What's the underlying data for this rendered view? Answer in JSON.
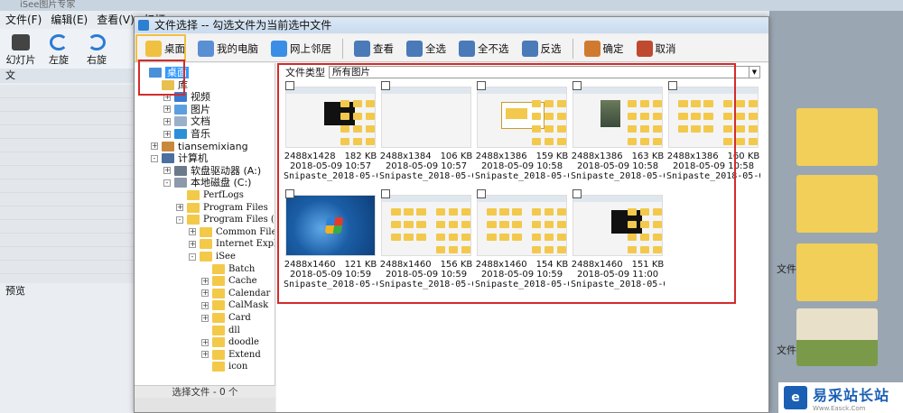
{
  "app": {
    "title": "iSee图片专家",
    "menus": [
      "文件(F)",
      "编辑(E)",
      "查看(V)",
      "幻灯"
    ],
    "toolbar": [
      {
        "label": "幻灯片",
        "icon": "film-icon"
      },
      {
        "label": "左旋",
        "icon": "rotate-left-icon"
      },
      {
        "label": "右旋",
        "icon": "rotate-right-icon"
      }
    ],
    "left_tab": "文",
    "preview_label": "预览",
    "right_folder_labels": [
      "文件",
      "文件"
    ]
  },
  "dialog": {
    "title": "文件选择 -- 勾选文件为当前选中文件",
    "toolbar": [
      {
        "label": "桌面",
        "icon": "desktop-icon",
        "color": "#f0c040"
      },
      {
        "label": "我的电脑",
        "icon": "computer-icon",
        "color": "#5b8fd4"
      },
      {
        "label": "网上邻居",
        "icon": "network-icon",
        "color": "#3a8ee6"
      },
      {
        "label": "查看",
        "icon": "view-grid-icon",
        "color": "#4a7ab8"
      },
      {
        "label": "全选",
        "icon": "select-all-icon",
        "color": "#4a7ab8"
      },
      {
        "label": "全不选",
        "icon": "select-none-icon",
        "color": "#4a7ab8"
      },
      {
        "label": "反选",
        "icon": "invert-selection-icon",
        "color": "#4a7ab8"
      },
      {
        "label": "确定",
        "icon": "confirm-icon",
        "color": "#d07a30"
      },
      {
        "label": "取消",
        "icon": "cancel-icon",
        "color": "#c04a30"
      }
    ],
    "tree": [
      {
        "label": "桌面",
        "level": 0,
        "expander": "",
        "icon": "desktop-icon",
        "selected": true
      },
      {
        "label": "库",
        "level": 1,
        "expander": "",
        "icon": "library-icon"
      },
      {
        "label": "视频",
        "level": 2,
        "expander": "+",
        "icon": "video-icon"
      },
      {
        "label": "图片",
        "level": 2,
        "expander": "+",
        "icon": "picture-icon"
      },
      {
        "label": "文档",
        "level": 2,
        "expander": "+",
        "icon": "document-icon"
      },
      {
        "label": "音乐",
        "level": 2,
        "expander": "+",
        "icon": "music-icon"
      },
      {
        "label": "tiansemixiang",
        "level": 1,
        "expander": "+",
        "icon": "user-folder-icon"
      },
      {
        "label": "计算机",
        "level": 1,
        "expander": "-",
        "icon": "computer-icon"
      },
      {
        "label": "软盘驱动器 (A:)",
        "level": 2,
        "expander": "+",
        "icon": "floppy-icon"
      },
      {
        "label": "本地磁盘 (C:)",
        "level": 2,
        "expander": "-",
        "icon": "disk-icon"
      },
      {
        "label": "PerfLogs",
        "level": 3,
        "expander": "",
        "icon": "folder-icon",
        "mono": true
      },
      {
        "label": "Program Files",
        "level": 3,
        "expander": "+",
        "icon": "folder-icon",
        "mono": true
      },
      {
        "label": "Program Files (x86",
        "level": 3,
        "expander": "-",
        "icon": "folder-icon",
        "mono": true
      },
      {
        "label": "Common Files",
        "level": 4,
        "expander": "+",
        "icon": "folder-icon",
        "mono": true
      },
      {
        "label": "Internet Explor",
        "level": 4,
        "expander": "+",
        "icon": "folder-icon",
        "mono": true
      },
      {
        "label": "iSee",
        "level": 4,
        "expander": "-",
        "icon": "folder-icon",
        "mono": true
      },
      {
        "label": "Batch",
        "level": 5,
        "expander": "",
        "icon": "folder-icon",
        "mono": true
      },
      {
        "label": "Cache",
        "level": 5,
        "expander": "+",
        "icon": "folder-icon",
        "mono": true
      },
      {
        "label": "Calendar",
        "level": 5,
        "expander": "+",
        "icon": "folder-icon",
        "mono": true
      },
      {
        "label": "CalMask",
        "level": 5,
        "expander": "+",
        "icon": "folder-icon",
        "mono": true
      },
      {
        "label": "Card",
        "level": 5,
        "expander": "+",
        "icon": "folder-icon",
        "mono": true
      },
      {
        "label": "dll",
        "level": 5,
        "expander": "",
        "icon": "folder-icon",
        "mono": true
      },
      {
        "label": "doodle",
        "level": 5,
        "expander": "+",
        "icon": "folder-icon",
        "mono": true
      },
      {
        "label": "Extend",
        "level": 5,
        "expander": "+",
        "icon": "folder-icon",
        "mono": true
      },
      {
        "label": "icon",
        "level": 5,
        "expander": "",
        "icon": "folder-icon",
        "mono": true
      }
    ],
    "status": "选择文件 - 0 个",
    "filter": {
      "label": "文件类型",
      "value": "所有图片"
    },
    "thumbnails": [
      {
        "dims": "2488x1428",
        "size": "182 KB",
        "date": "2018-05-09 10:57",
        "name": "Snipaste_2018-05-0...",
        "kind": "black-panel"
      },
      {
        "dims": "2488x1384",
        "size": "106 KB",
        "date": "2018-05-09 10:57",
        "name": "Snipaste_2018-05-0...",
        "kind": "plain"
      },
      {
        "dims": "2488x1386",
        "size": "159 KB",
        "date": "2018-05-09 10:58",
        "name": "Snipaste_2018-05-0...",
        "kind": "dialog"
      },
      {
        "dims": "2488x1386",
        "size": "163 KB",
        "date": "2018-05-09 10:58",
        "name": "Snipaste_2018-05-0...",
        "kind": "photo"
      },
      {
        "dims": "2488x1386",
        "size": "160 KB",
        "date": "2018-05-09 10:58",
        "name": "Snipaste_2018-05-0...",
        "kind": "folders"
      },
      {
        "dims": "2488x1460",
        "size": "121 KB",
        "date": "2018-05-09 10:59",
        "name": "Snipaste_2018-05-0...",
        "kind": "windows"
      },
      {
        "dims": "2488x1460",
        "size": "156 KB",
        "date": "2018-05-09 10:59",
        "name": "Snipaste_2018-05-0...",
        "kind": "folders"
      },
      {
        "dims": "2488x1460",
        "size": "154 KB",
        "date": "2018-05-09 10:59",
        "name": "Snipaste_2018-05-0...",
        "kind": "folders"
      },
      {
        "dims": "2488x1460",
        "size": "151 KB",
        "date": "2018-05-09 11:00",
        "name": "Snipaste_2018-05-0...",
        "kind": "black-panel"
      }
    ]
  },
  "watermark": {
    "text": "易采站长站",
    "sub": "Www.Easck.Com",
    "logo_letter": "e"
  },
  "colors": {
    "highlight_red": "#d42b2b",
    "highlight_yellow": "#f0c040",
    "folder": "#f3c94a"
  }
}
